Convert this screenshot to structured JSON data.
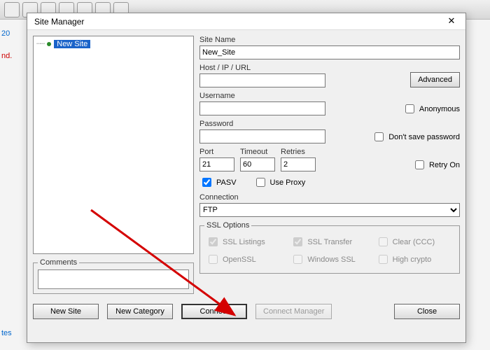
{
  "dialog": {
    "title": "Site Manager"
  },
  "tree": {
    "selected_label": "New Site"
  },
  "comments": {
    "legend": "Comments"
  },
  "fields": {
    "site_name_label": "Site Name",
    "site_name_value": "New_Site",
    "host_label": "Host / IP / URL",
    "host_value": "",
    "advanced_btn": "Advanced",
    "username_label": "Username",
    "username_value": "",
    "anonymous_label": "Anonymous",
    "anonymous_checked": false,
    "password_label": "Password",
    "password_value": "",
    "dont_save_label": "Don't save password",
    "dont_save_checked": false,
    "port_label": "Port",
    "port_value": "21",
    "timeout_label": "Timeout",
    "timeout_value": "60",
    "retries_label": "Retries",
    "retries_value": "2",
    "retry_on_label": "Retry On",
    "retry_on_checked": false,
    "pasv_label": "PASV",
    "pasv_checked": true,
    "use_proxy_label": "Use Proxy",
    "use_proxy_checked": false,
    "connection_label": "Connection",
    "connection_value": "FTP"
  },
  "ssl": {
    "legend": "SSL Options",
    "listings_label": "SSL Listings",
    "listings_checked": true,
    "transfer_label": "SSL Transfer",
    "transfer_checked": true,
    "clear_label": "Clear (CCC)",
    "clear_checked": false,
    "openssl_label": "OpenSSL",
    "openssl_checked": false,
    "winssl_label": "Windows SSL",
    "winssl_checked": false,
    "highcrypto_label": "High crypto",
    "highcrypto_checked": false
  },
  "buttons": {
    "new_site": "New Site",
    "new_category": "New Category",
    "connect": "Connect",
    "connect_manager": "Connect Manager",
    "close": "Close"
  },
  "behind_fragments": {
    "text1": "20",
    "text2": "nd.",
    "text3": "tes"
  }
}
